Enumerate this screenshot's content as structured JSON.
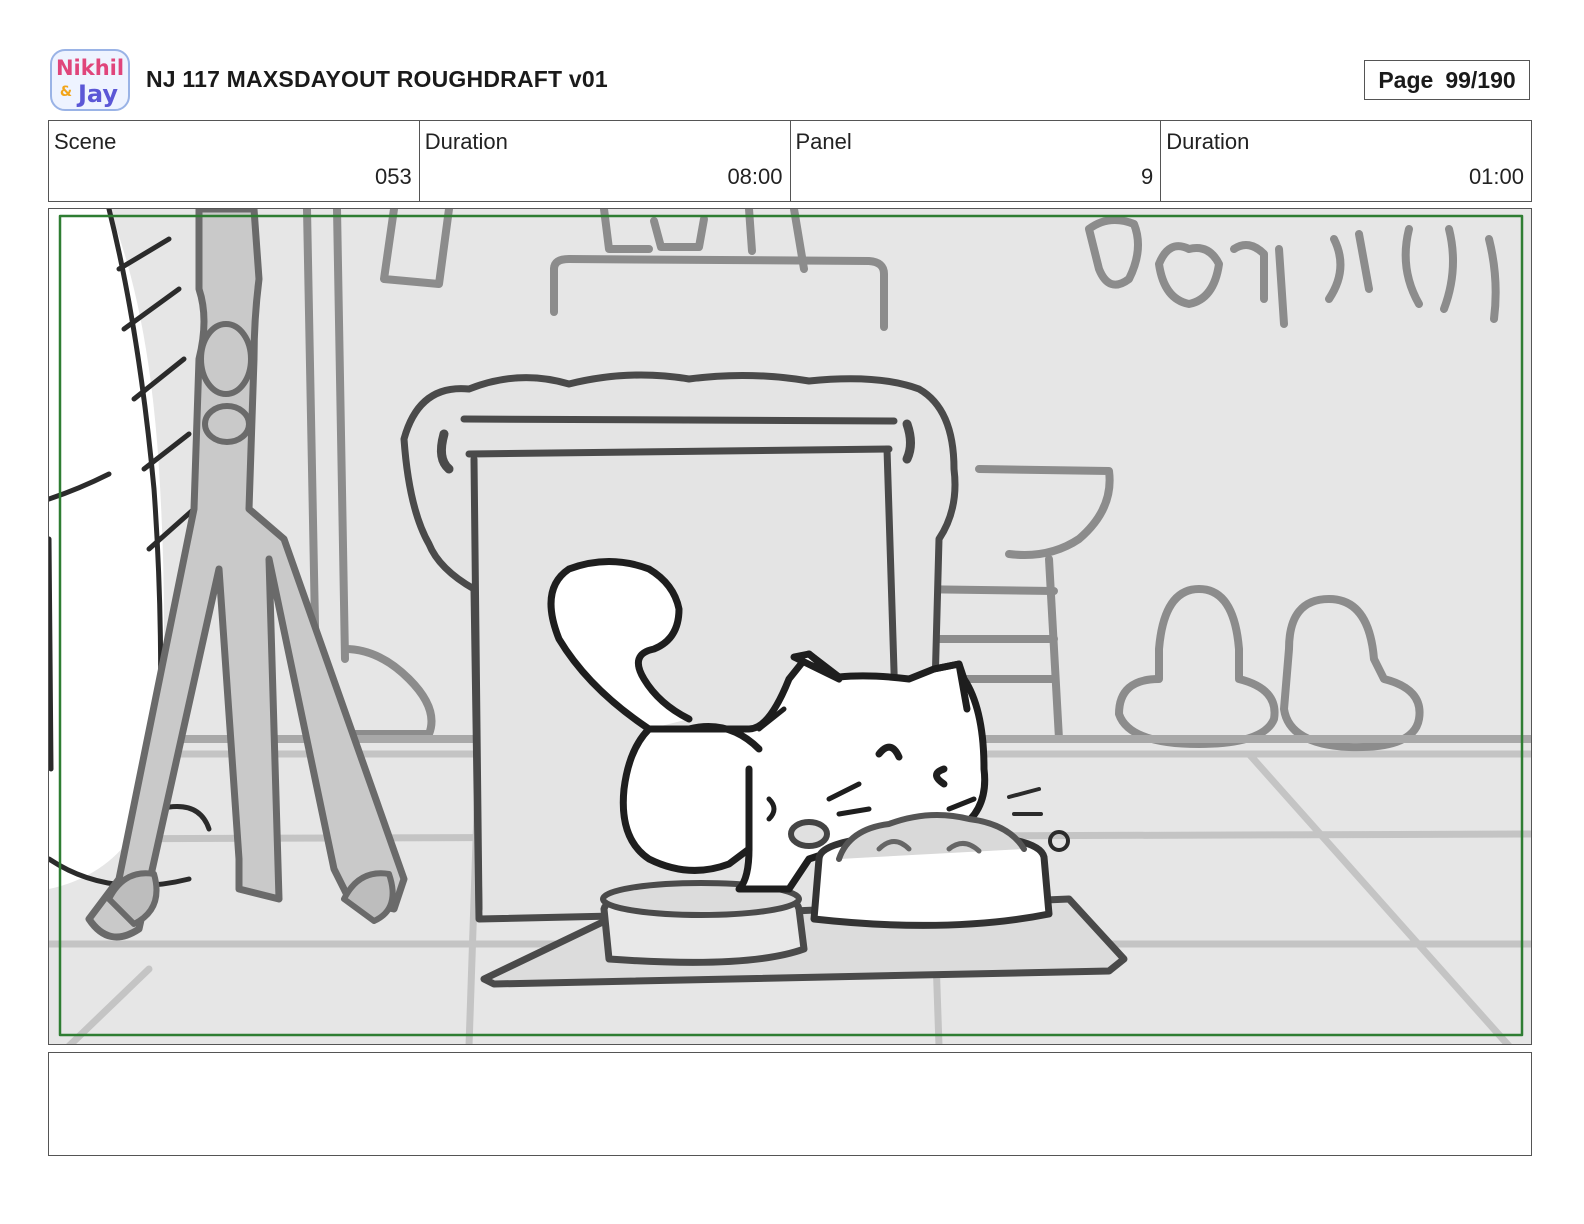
{
  "header": {
    "logo_text": "Nikhil & Jay",
    "title": "NJ 117 MAXSDAYOUT ROUGHDRAFT v01",
    "page_label": "Page",
    "page_value": "99/190"
  },
  "info": [
    {
      "label": "Scene",
      "value": "053"
    },
    {
      "label": "Duration",
      "value": "08:00"
    },
    {
      "label": "Panel",
      "value": "9"
    },
    {
      "label": "Duration",
      "value": "01:00"
    }
  ],
  "panel": {
    "safe_frame_color": "#2e7d32"
  },
  "notes": {
    "text": ""
  }
}
